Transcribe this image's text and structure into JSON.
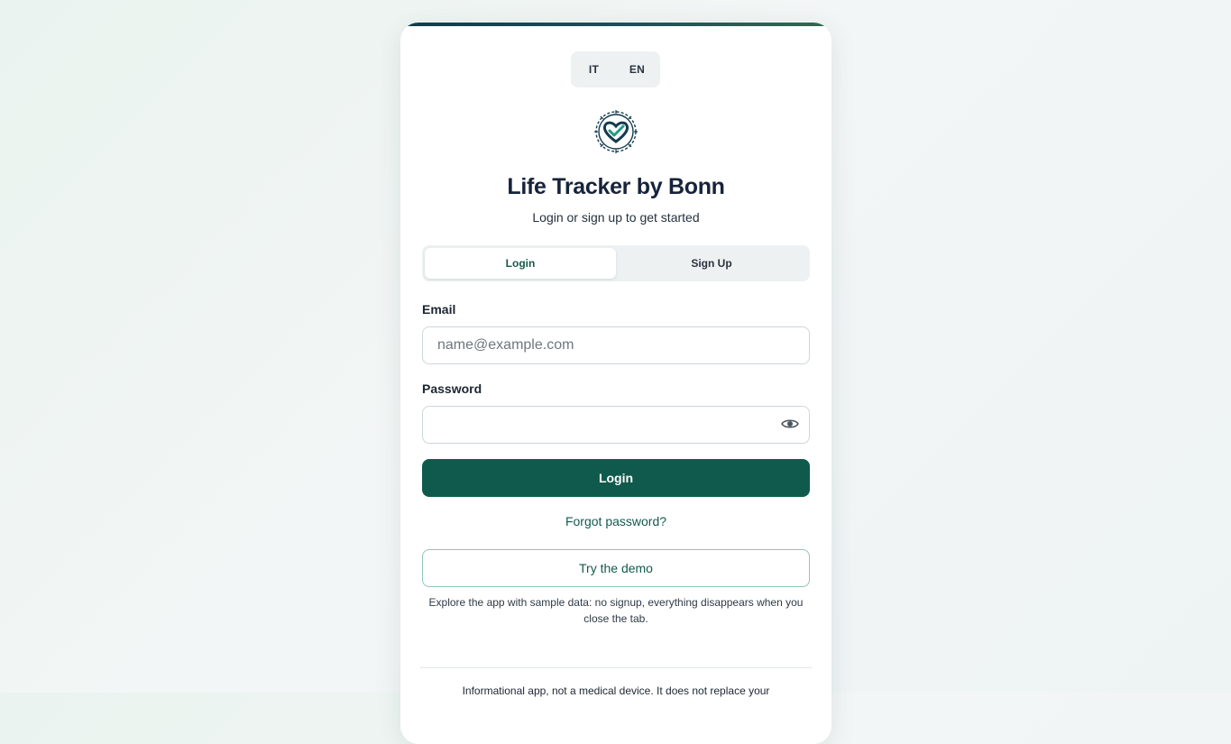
{
  "language": {
    "options": [
      "IT",
      "EN"
    ],
    "selected": "EN"
  },
  "app": {
    "title": "Life Tracker by Bonn",
    "subtitle": "Login or sign up to get started"
  },
  "tabs": [
    {
      "label": "Login",
      "active": true
    },
    {
      "label": "Sign Up",
      "active": false
    }
  ],
  "form": {
    "email_label": "Email",
    "email_placeholder": "name@example.com",
    "email_value": "",
    "password_label": "Password",
    "password_value": "",
    "submit_label": "Login",
    "forgot_label": "Forgot password?"
  },
  "demo": {
    "button_label": "Try the demo",
    "note": "Explore the app with sample data: no signup, everything disappears when you close the tab."
  },
  "footer": {
    "disclaimer": "Informational app, not a medical device. It does not replace your"
  },
  "colors": {
    "primary": "#0f5a4c",
    "accent_text": "#135a4b",
    "demo_border": "#8fc7b8"
  },
  "icons": {
    "logo": "heart-check-gear-icon",
    "password_toggle": "eye-icon"
  }
}
